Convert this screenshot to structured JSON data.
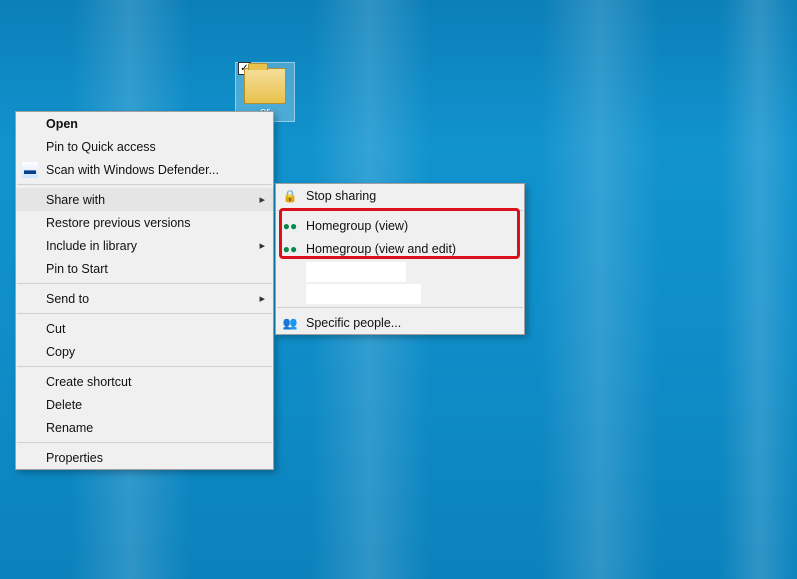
{
  "desktop": {
    "folder_label": "er"
  },
  "context_menu": {
    "open": "Open",
    "pin_quick": "Pin to Quick access",
    "scan_defender": "Scan with Windows Defender...",
    "share_with": "Share with",
    "restore_prev": "Restore previous versions",
    "include_library": "Include in library",
    "pin_start": "Pin to Start",
    "send_to": "Send to",
    "cut": "Cut",
    "copy": "Copy",
    "create_shortcut": "Create shortcut",
    "delete": "Delete",
    "rename": "Rename",
    "properties": "Properties"
  },
  "share_submenu": {
    "stop": "Stop sharing",
    "hg_view": "Homegroup (view)",
    "hg_edit": "Homegroup (view and edit)",
    "specific": "Specific people..."
  }
}
